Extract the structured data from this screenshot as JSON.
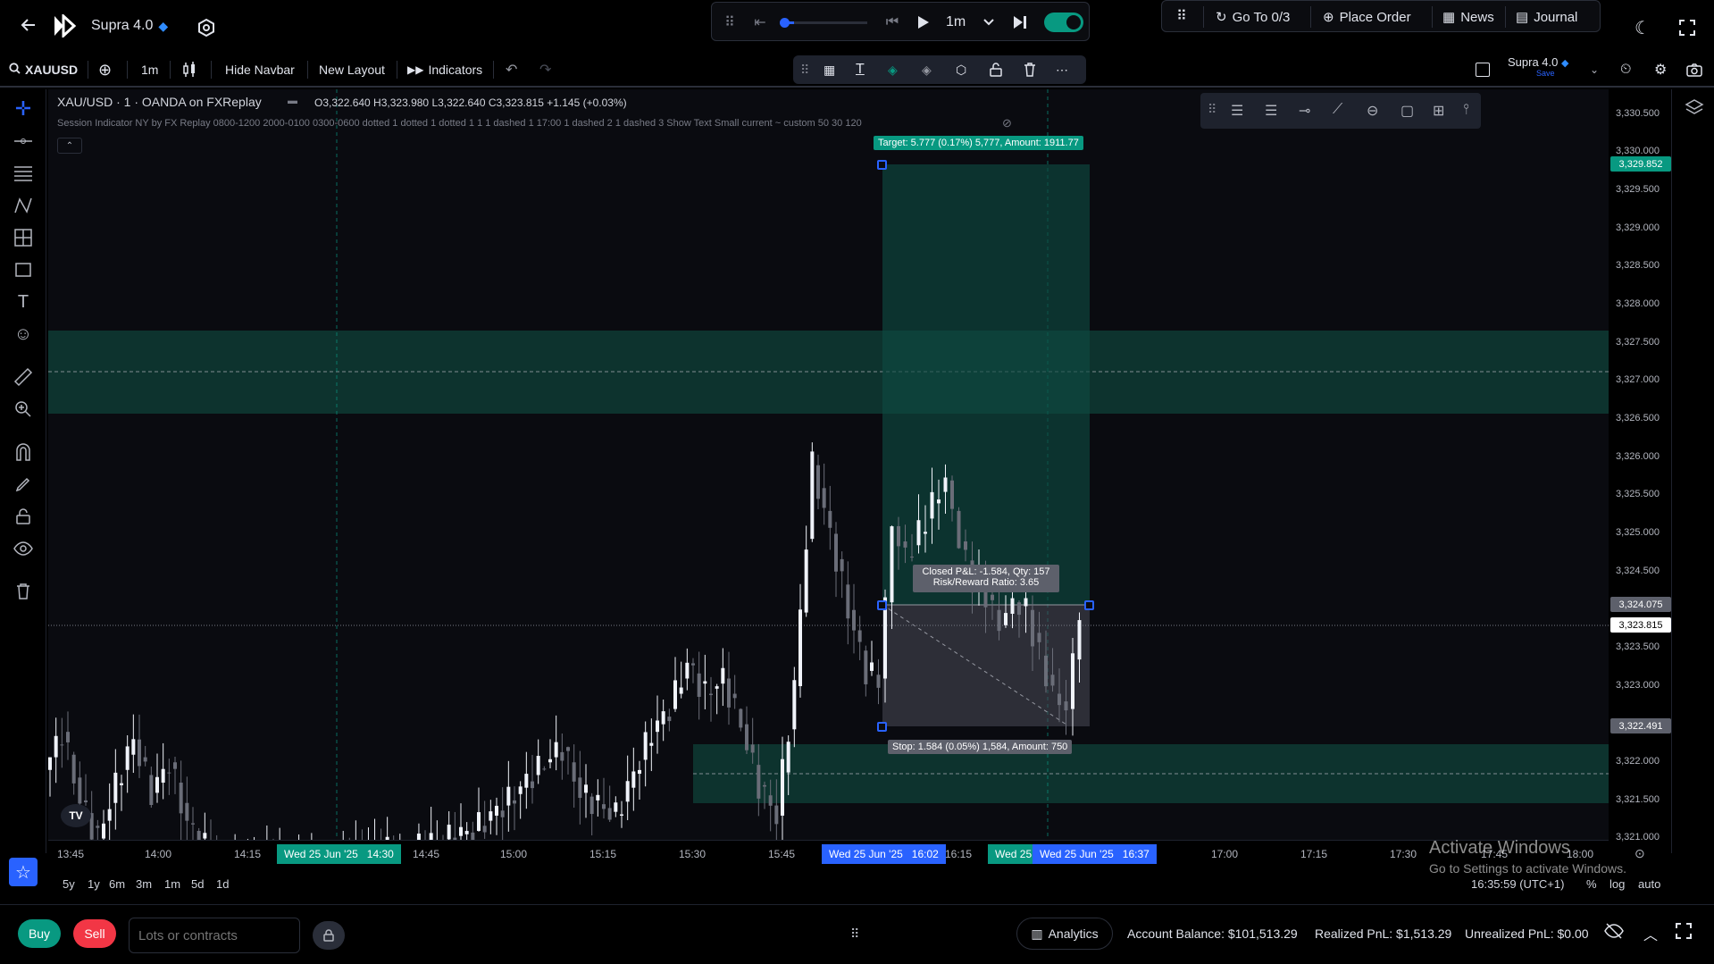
{
  "app": {
    "layout_name": "Supra 4.0",
    "save_label": "Save"
  },
  "playback": {
    "timeframe": "1m"
  },
  "top_menu": {
    "goto": "Go To 0/3",
    "place_order": "Place Order",
    "news": "News",
    "journal": "Journal"
  },
  "toolbar": {
    "symbol": "XAUUSD",
    "interval": "1m",
    "hide_navbar": "Hide Navbar",
    "new_layout": "New Layout",
    "indicators": "Indicators"
  },
  "legend": {
    "title": "XAU/USD · 1 · OANDA on FXReplay",
    "ohlc": "O3,322.640  H3,323.980  L3,322.640  C3,323.815  +1.145 (+0.03%)",
    "indicator": "Session Indicator NY by FX Replay 0800-1200 2000-0100 0300-0600 dotted 1 dotted 1 dotted 1 1 1 dashed 1 17:00 1 dashed 2 1 dashed 3 Show Text Small current ~ custom 50 30 120"
  },
  "position": {
    "target_label": "Target: 5.777 (0.17%) 5,777, Amount: 1911.77",
    "pnl_label": "Closed P&L: -1.584, Qty: 157",
    "rr_label": "Risk/Reward Ratio: 3.65",
    "stop_label": "Stop: 1.584 (0.05%) 1,584, Amount: 750"
  },
  "price_axis": {
    "labels": [
      "3,330.500",
      "3,330.000",
      "3,329.500",
      "3,329.000",
      "3,328.500",
      "3,328.000",
      "3,327.500",
      "3,327.000",
      "3,326.500",
      "3,326.000",
      "3,325.500",
      "3,325.000",
      "3,324.500",
      "3,323.500",
      "3,323.000",
      "3,322.000",
      "3,321.500",
      "3,321.000"
    ],
    "tag_target": "3,329.852",
    "tag_entry": "3,324.075",
    "tag_current": "3,323.815",
    "tag_stop": "3,322.491"
  },
  "time_axis": {
    "labels": [
      "13:45",
      "14:00",
      "14:15",
      "14:45",
      "15:00",
      "15:15",
      "15:30",
      "15:45",
      "16:15",
      "17:00",
      "17:15",
      "17:30",
      "17:45",
      "18:00"
    ],
    "tag_cursor": "Wed 25 Jun '25   14:30",
    "tag_entry": "Wed 25 Jun '25   16:02",
    "tag_exit_partial": "Wed 25",
    "tag_exit": "Wed 25 Jun '25   16:37"
  },
  "range_bar": {
    "ranges": [
      "5y",
      "1y",
      "6m",
      "3m",
      "1m",
      "5d",
      "1d"
    ],
    "clock": "16:35:59 (UTC+1)",
    "percent": "%",
    "log": "log",
    "auto": "auto"
  },
  "bottom": {
    "buy": "Buy",
    "sell": "Sell",
    "lots_placeholder": "Lots or contracts",
    "analytics": "Analytics",
    "account_balance": "Account Balance: $101,513.29",
    "realized_pnl": "Realized PnL: $1,513.29",
    "unrealized_pnl": "Unrealized PnL: $0.00"
  },
  "watermark": {
    "title": "Activate Windows",
    "subtitle": "Go to Settings to activate Windows."
  },
  "colors": {
    "accent": "#2962ff",
    "buy": "#089981",
    "sell": "#f23645",
    "zone": "#0e3b34",
    "toggle": "#089981"
  }
}
